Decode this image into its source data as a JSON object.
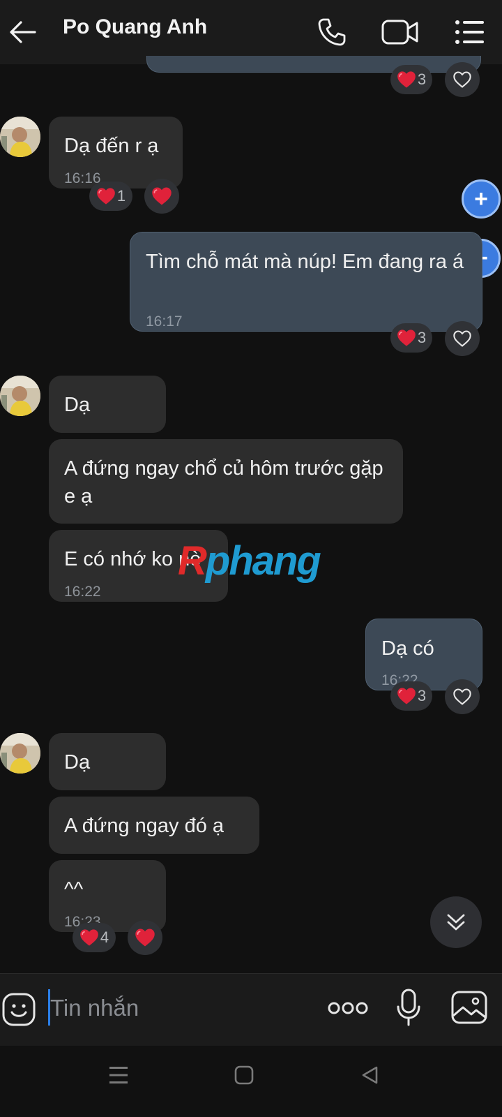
{
  "header": {
    "back_icon": "arrow-left-icon",
    "title": "Po Quang Anh",
    "call_icon": "phone-icon",
    "video_icon": "video-camera-icon",
    "menu_icon": "list-menu-icon"
  },
  "messages": [
    {
      "side": "out",
      "partial": true,
      "reactions": {
        "count": "3"
      }
    },
    {
      "side": "in",
      "text": "Dạ đến r ạ",
      "time": "16:16",
      "reactions": {
        "count": "1"
      }
    },
    {
      "side": "out",
      "text": "Tìm chỗ mát mà núp! Em đang ra á",
      "time": "16:17",
      "reactions": {
        "count": "3"
      }
    },
    {
      "side": "in",
      "text": "Dạ"
    },
    {
      "side": "in",
      "text": "A đứng ngay chổ củ hôm trước gặp e ạ"
    },
    {
      "side": "in",
      "text": "E có nhớ ko nè",
      "time": "16:22"
    },
    {
      "side": "out",
      "text": "Dạ có",
      "time": "16:22",
      "reactions": {
        "count": "3"
      }
    },
    {
      "side": "in",
      "text": "Dạ"
    },
    {
      "side": "in",
      "text": "A đứng ngay đó ạ"
    },
    {
      "side": "in",
      "text": "^^",
      "time": "16:23",
      "reactions": {
        "count": "4"
      }
    }
  ],
  "watermark": {
    "part1": "R",
    "part2": "phang"
  },
  "side_buttons": {
    "plus": "+",
    "minus": "−"
  },
  "composer": {
    "placeholder": "Tin nhắn",
    "emoji_icon": "emoji-icon",
    "more_icon": "more-dots-icon",
    "mic_icon": "microphone-icon",
    "image_icon": "image-icon"
  },
  "navbar": {
    "menu_icon": "recent-apps-icon",
    "home_icon": "home-icon",
    "back_icon": "back-triangle-icon"
  },
  "colors": {
    "background": "#111111",
    "incoming_bubble": "#2d2d2d",
    "outgoing_bubble": "#3d4956",
    "heart": "#e0223a",
    "accent": "#3b7be0"
  }
}
